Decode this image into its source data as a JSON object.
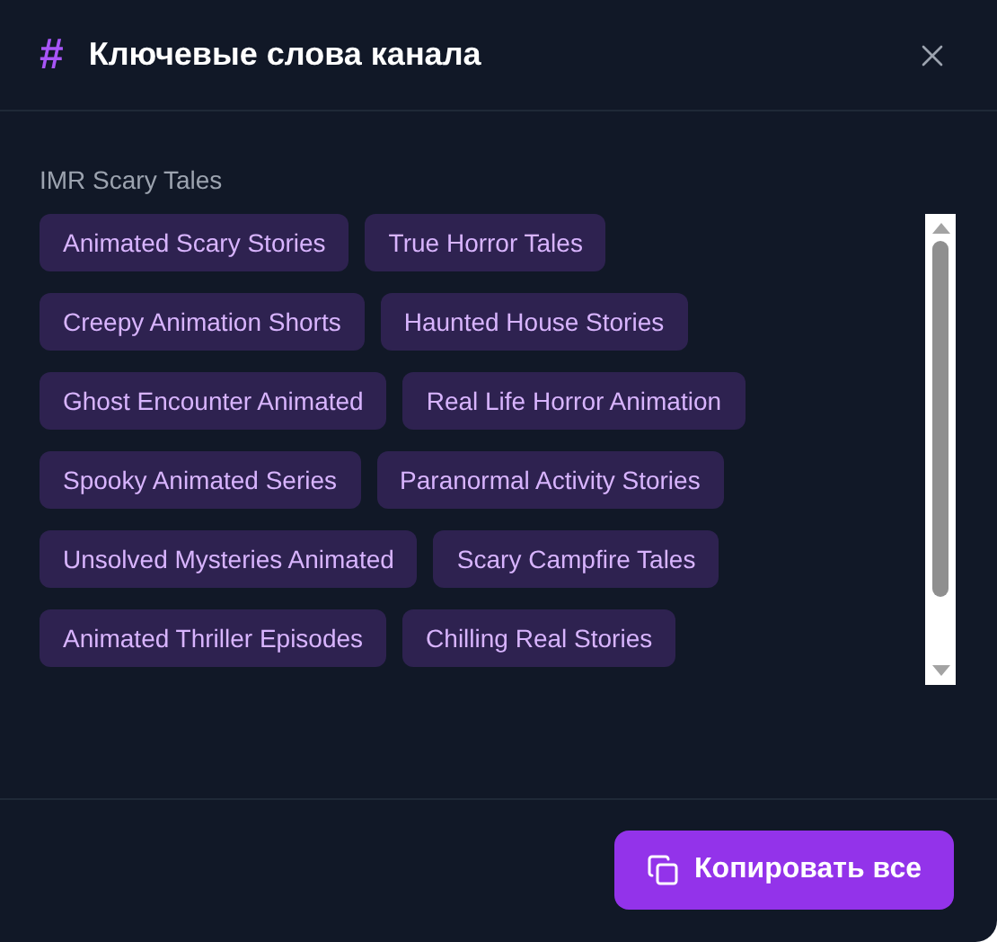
{
  "dialog": {
    "icon": "#",
    "title": "Ключевые слова канала"
  },
  "channel_name": "IMR Scary Tales",
  "keywords": [
    "Animated Scary Stories",
    "True Horror Tales",
    "Creepy Animation Shorts",
    "Haunted House Stories",
    "Ghost Encounter Animated",
    "Real Life Horror Animation",
    "Spooky Animated Series",
    "Paranormal Activity Stories",
    "Unsolved Mysteries Animated",
    "Scary Campfire Tales",
    "Animated Thriller Episodes",
    "Chilling Real Stories"
  ],
  "copy_button": "Копировать все"
}
